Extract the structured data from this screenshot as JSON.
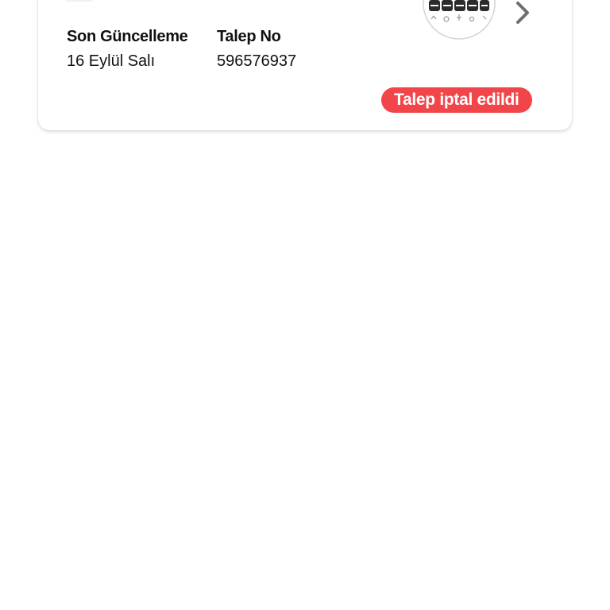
{
  "card": {
    "updated_label": "Son Güncelleme",
    "updated_value": "16 Eylül Salı",
    "request_label": "Talep No",
    "request_value": "596576937",
    "status": "Talep iptal edildi",
    "status_color": "#f2454a",
    "thumbnail_icon": "product-thumbnail",
    "action_icon": "chevron-right-icon"
  }
}
